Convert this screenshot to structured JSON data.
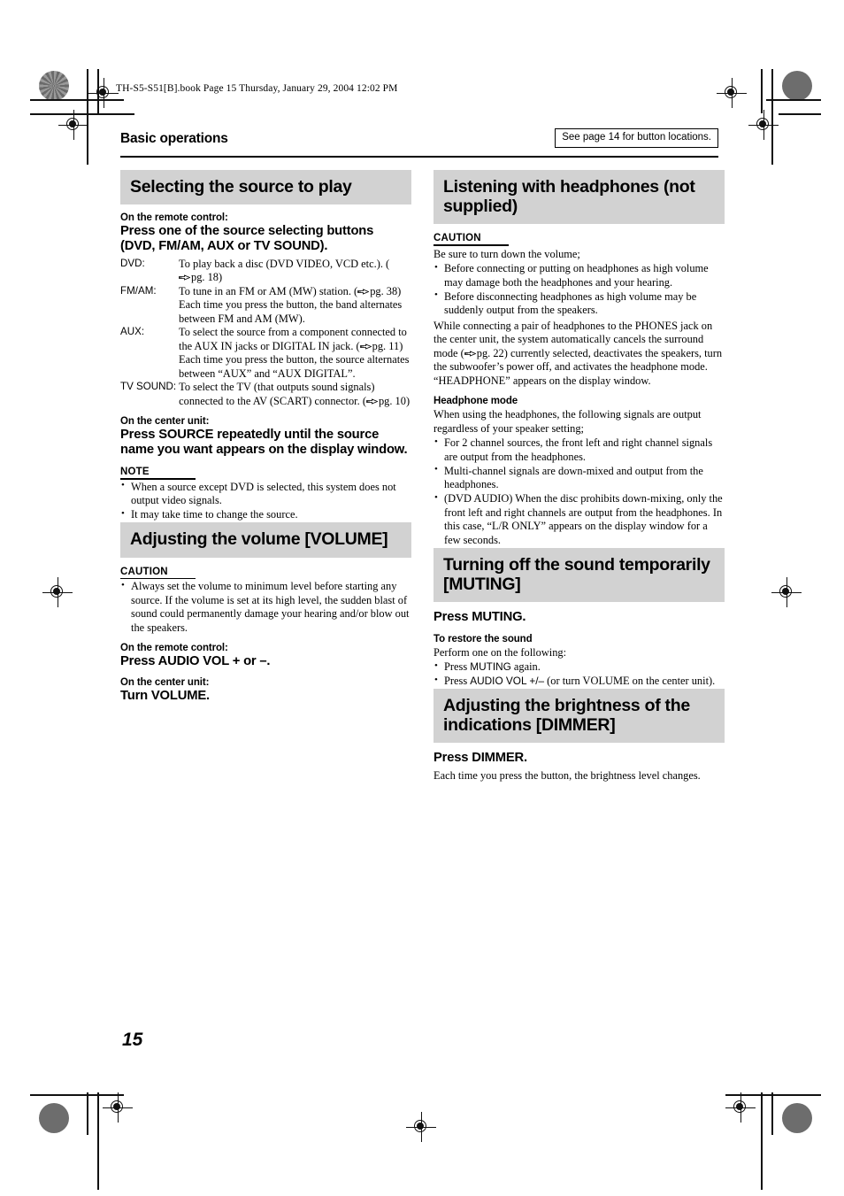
{
  "print_marks": {
    "file_info": "TH-S5-S51[B].book  Page 15  Thursday, January 29, 2004  12:02 PM"
  },
  "header": {
    "title": "Basic operations",
    "reference_note": "See page 14 for button locations."
  },
  "page_number": "15",
  "left_column": [
    {
      "type": "section",
      "heading": "Selecting the source to play",
      "blocks": [
        {
          "type": "subhead",
          "text": "On the remote control:"
        },
        {
          "type": "instruction",
          "text": "Press one of the source selecting buttons (DVD, FM/AM, AUX or TV SOUND)."
        },
        {
          "type": "deflist",
          "rows": [
            {
              "term": "DVD:",
              "desc": "To play back a disc (DVD VIDEO, VCD etc.). (",
              "pgref": "pg. 18",
              "desc_tail": ")"
            },
            {
              "term": "FM/AM:",
              "desc": "To tune in an FM or AM (MW) station. (",
              "pgref": "pg. 38",
              "desc_tail": ") Each time you press the button, the band alternates between FM and AM (MW)."
            },
            {
              "term": "AUX:",
              "desc": "To select the source from a component connected to the AUX IN jacks or DIGITAL IN jack. (",
              "pgref": "pg. 11",
              "desc_tail": ") Each time you press the button, the source alternates between “AUX” and “AUX DIGITAL”."
            },
            {
              "term": "TV SOUND:",
              "desc": "To select the TV (that outputs sound signals) connected to the AV (SCART) connector. (",
              "pgref": "pg. 10",
              "desc_tail": ")"
            }
          ]
        },
        {
          "type": "subhead",
          "text": "On the center unit:"
        },
        {
          "type": "instruction",
          "text": "Press SOURCE repeatedly until the source name you want appears on the display window."
        },
        {
          "type": "label_rule",
          "text": "NOTE"
        },
        {
          "type": "bullets",
          "items": [
            "When a source except DVD is selected, this system does not output video signals.",
            "It may take time to change the source."
          ]
        }
      ]
    },
    {
      "type": "section",
      "heading": "Adjusting the volume [VOLUME]",
      "blocks": [
        {
          "type": "label_rule",
          "text": "CAUTION"
        },
        {
          "type": "bullets",
          "items": [
            "Always set the volume to minimum level before starting any source. If the volume is set at its high level, the sudden blast of sound could permanently damage your hearing and/or blow out the speakers."
          ]
        },
        {
          "type": "subhead",
          "text": "On the remote control:"
        },
        {
          "type": "instruction",
          "text": "Press AUDIO VOL + or –."
        },
        {
          "type": "subhead",
          "text": "On the center unit:"
        },
        {
          "type": "instruction",
          "text": "Turn VOLUME."
        }
      ]
    }
  ],
  "right_column": [
    {
      "type": "section",
      "heading": "Listening with headphones (not supplied)",
      "blocks": [
        {
          "type": "label_rule",
          "text": "CAUTION"
        },
        {
          "type": "body",
          "text": "Be sure to turn down the volume;"
        },
        {
          "type": "bullets",
          "items": [
            "Before connecting or putting on headphones as high volume may damage both the headphones and your hearing.",
            "Before disconnecting headphones as high volume may be suddenly output from the speakers."
          ]
        },
        {
          "type": "body_pgref",
          "text_before": "While connecting a pair of headphones to the PHONES jack on the center unit, the system automatically cancels the surround mode (",
          "pgref": "pg. 22",
          "text_after": ") currently selected, deactivates the speakers, turn the subwoofer’s power off, and activates the headphone mode. “HEADPHONE” appears on the display window."
        },
        {
          "type": "subhead",
          "text": "Headphone mode"
        },
        {
          "type": "body",
          "text": "When using the headphones, the following signals are output regardless of your speaker setting;"
        },
        {
          "type": "bullets",
          "items": [
            "For 2 channel sources, the front left and right channel signals are output from the headphones.",
            "Multi-channel signals are down-mixed and output from the headphones.",
            "(DVD AUDIO) When the disc prohibits down-mixing, only the front left and right channels are output from the headphones. In this case, “L/R ONLY” appears on the display window for a few seconds."
          ]
        }
      ]
    },
    {
      "type": "section",
      "heading": "Turning off the sound temporarily [MUTING]",
      "blocks": [
        {
          "type": "instruction",
          "text": "Press MUTING."
        },
        {
          "type": "subhead",
          "text": "To restore the sound"
        },
        {
          "type": "body",
          "text": "Perform one on the following:"
        },
        {
          "type": "bullets_mixed",
          "items": [
            {
              "btn": "MUTING",
              "before": "Press ",
              "after": " again."
            },
            {
              "btn": "AUDIO VOL +/–",
              "before": "Press ",
              "after": " (or turn VOLUME on the center unit)."
            }
          ]
        }
      ]
    },
    {
      "type": "section",
      "heading": "Adjusting the brightness of the indications [DIMMER]",
      "blocks": [
        {
          "type": "instruction",
          "text": "Press DIMMER."
        },
        {
          "type": "body",
          "text": "Each time you press the button, the brightness level changes."
        }
      ]
    }
  ]
}
